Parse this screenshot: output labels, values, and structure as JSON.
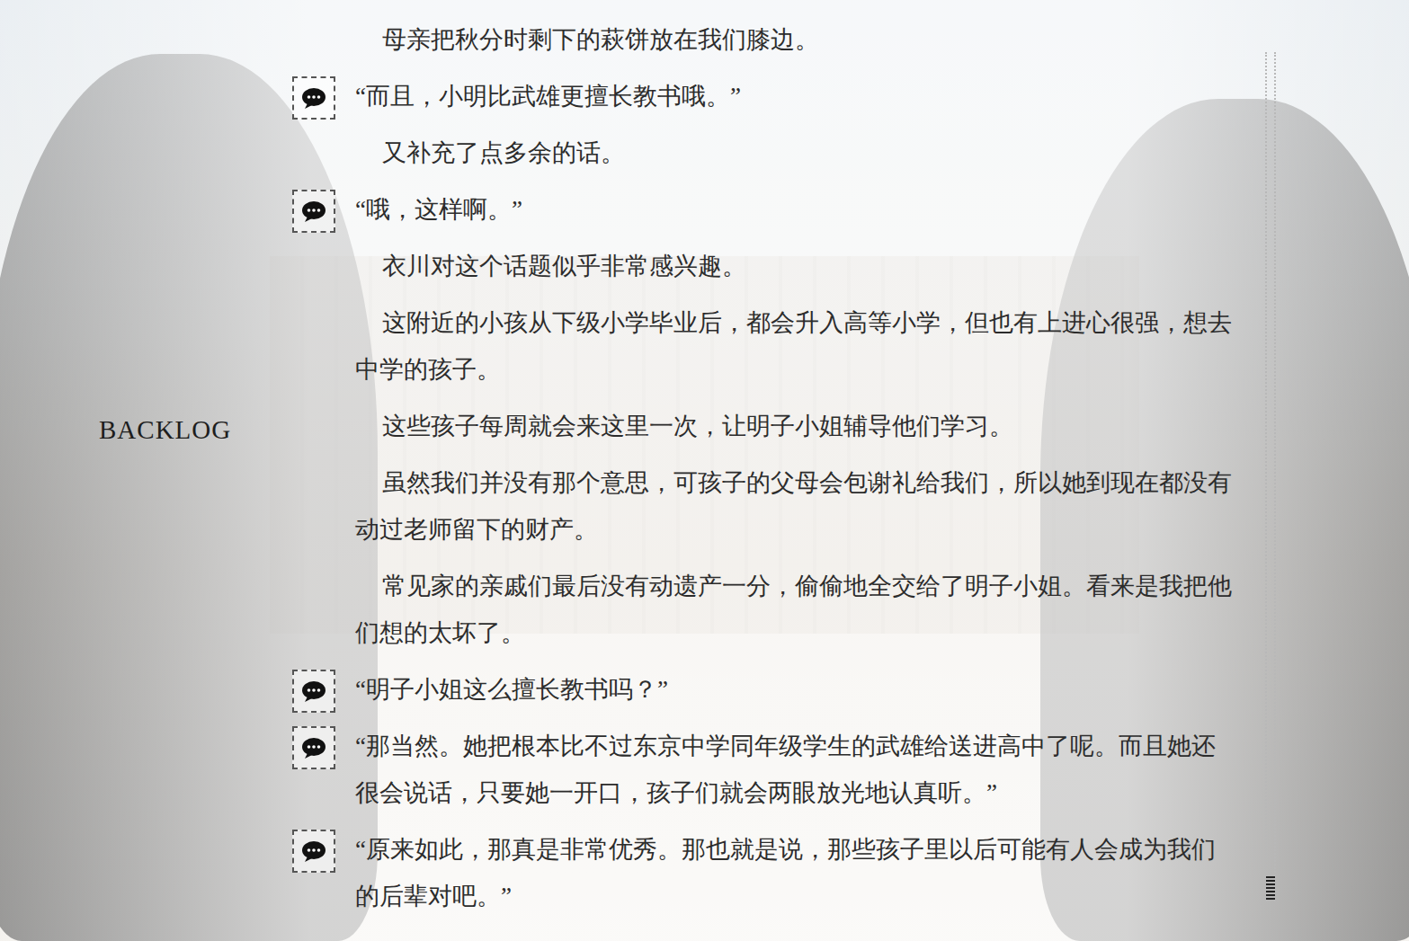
{
  "screen": {
    "title": "BACKLOG"
  },
  "entries": [
    {
      "kind": "narration",
      "text": "母亲把秋分时剩下的萩饼放在我们膝边。"
    },
    {
      "kind": "dialogue",
      "text": "“而且，小明比武雄更擅长教书哦。”"
    },
    {
      "kind": "narration",
      "text": "又补充了点多余的话。"
    },
    {
      "kind": "dialogue",
      "text": "“哦，这样啊。”"
    },
    {
      "kind": "narration",
      "text": "衣川对这个话题似乎非常感兴趣。"
    },
    {
      "kind": "narration",
      "text": "这附近的小孩从下级小学毕业后，都会升入高等小学，但也有上进心很强，想去中学的孩子。"
    },
    {
      "kind": "narration",
      "text": "这些孩子每周就会来这里一次，让明子小姐辅导他们学习。"
    },
    {
      "kind": "narration",
      "text": "虽然我们并没有那个意思，可孩子的父母会包谢礼给我们，所以她到现在都没有动过老师留下的财产。"
    },
    {
      "kind": "narration",
      "text": "常见家的亲戚们最后没有动遗产一分，偷偷地全交给了明子小姐。看来是我把他们想的太坏了。"
    },
    {
      "kind": "dialogue",
      "text": "“明子小姐这么擅长教书吗？”"
    },
    {
      "kind": "dialogue",
      "text": "“那当然。她把根本比不过东京中学同年级学生的武雄给送进高中了呢。而且她还很会说话，只要她一开口，孩子们就会两眼放光地认真听。”"
    },
    {
      "kind": "dialogue",
      "text": "“原来如此，那真是非常优秀。那也就是说，那些孩子里以后可能有人会成为我们的后辈对吧。”"
    }
  ],
  "scrollbar": {
    "level": 1
  }
}
